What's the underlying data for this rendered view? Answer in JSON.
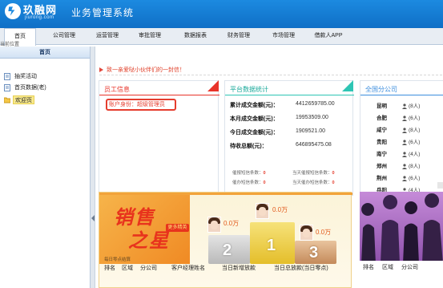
{
  "header": {
    "logo_text": "玖融网",
    "logo_sub": "jiurong.com",
    "system_title": "业务管理系统"
  },
  "nav": {
    "items": [
      {
        "label": "首页",
        "active": true
      },
      {
        "label": "公司管理"
      },
      {
        "label": "运营管理"
      },
      {
        "label": "审批管理"
      },
      {
        "label": "数据报表"
      },
      {
        "label": "财务管理"
      },
      {
        "label": "市场管理"
      },
      {
        "label": "借款人APP"
      }
    ]
  },
  "breadcrumb": "当前位置",
  "sidebar": {
    "title": "首页",
    "items": [
      {
        "label": "抽奖活动"
      },
      {
        "label": "首页数据(老)"
      },
      {
        "label": "欢迎页",
        "selected": true
      }
    ]
  },
  "notice": {
    "text": "致一亲爱哒小伙伴们的一封信！"
  },
  "staff_card": {
    "title": "员工信息",
    "identity_label": "账户身份：",
    "identity_value": "超级管理员"
  },
  "platform_card": {
    "title": "平台数据统计",
    "rows": [
      {
        "label": "累计成交金额(元)：",
        "value": "4412659785.00"
      },
      {
        "label": "本月成交金额(元)：",
        "value": "19953509.00"
      },
      {
        "label": "今日成交金额(元)：",
        "value": "1909521.00"
      },
      {
        "label": "待收总额(元)：",
        "value": "646895475.08"
      }
    ],
    "sms": [
      {
        "label": "催报短信条数：",
        "value": "0"
      },
      {
        "label": "当天催报短信条数：",
        "value": "0"
      },
      {
        "label": "催办短信条数：",
        "value": "0"
      },
      {
        "label": "当天催办短信条数：",
        "value": "0"
      }
    ]
  },
  "branches_card": {
    "title": "全国分公司",
    "rows": [
      {
        "city": "昆明",
        "count": "(8人)"
      },
      {
        "city": "合肥",
        "count": "(6人)"
      },
      {
        "city": "咸宁",
        "count": "(8人)"
      },
      {
        "city": "贵阳",
        "count": "(6人)"
      },
      {
        "city": "南宁",
        "count": "(4人)"
      },
      {
        "city": "郑州",
        "count": "(8人)"
      },
      {
        "city": "荆州",
        "count": "(6人)"
      },
      {
        "city": "岳阳",
        "count": "(4人)"
      }
    ]
  },
  "sales_star": {
    "title1": "销售",
    "title2": "之星",
    "badge": "更多精英",
    "daily_note": "每日零点结算",
    "amount_first": "0.0万",
    "amount_second": "0.0万",
    "amount_third": "0.0万",
    "rank1": "1",
    "rank2": "2",
    "rank3": "3",
    "headers": [
      "排名",
      "区域",
      "分公司",
      "客户经理姓名",
      "当日新增放款",
      "当日总放款(当日零点)"
    ]
  },
  "right_panel": {
    "headers": [
      "排名",
      "区域",
      "分公司"
    ]
  },
  "colors": {
    "header_blue": "#1c8ae0",
    "accent_red": "#e53d2e",
    "staff_line": "#e8332a",
    "platform_line": "#2ec5b4",
    "branch_line": "#3d8ede",
    "banner_orange": "#f2a33a"
  },
  "icons": {
    "logo": "jiurong-logo-icon",
    "page": "page-icon",
    "folder": "folder-icon",
    "notice": "triangle-arrow-icon",
    "person": "person-icon"
  }
}
